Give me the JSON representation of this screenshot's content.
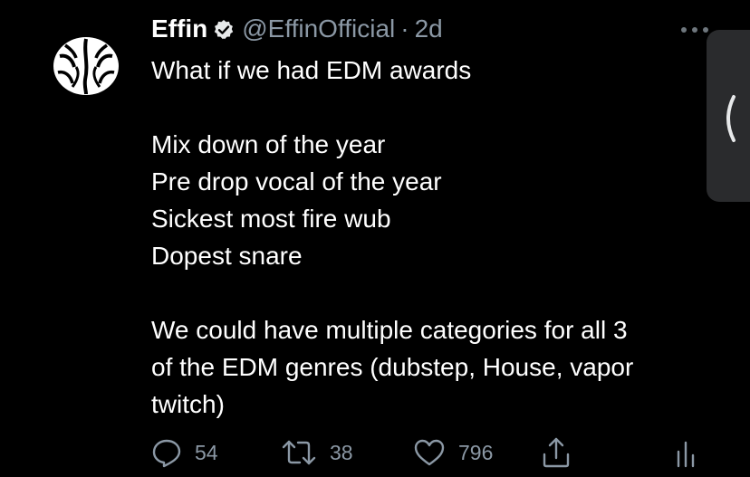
{
  "tweet": {
    "display_name": "Effin",
    "handle": "@EffinOfficial",
    "separator": "·",
    "time": "2d",
    "lines": [
      "What if we had EDM awards",
      "",
      "Mix down of the year",
      "Pre drop vocal of the year",
      "Sickest most fire wub",
      "Dopest snare",
      "",
      "We could have multiple categories for all 3",
      "of the EDM genres (dubstep, House, vapor",
      "twitch)"
    ],
    "stats": {
      "replies": "54",
      "retweets": "38",
      "likes": "796"
    }
  },
  "icons": {
    "verified": "verified-badge-icon",
    "more": "more-dots-icon",
    "reply": "reply-icon",
    "retweet": "retweet-icon",
    "like": "heart-icon",
    "share": "share-icon",
    "analytics": "analytics-icon",
    "side_tab": "chevron-left-icon"
  },
  "colors": {
    "background": "#000000",
    "text": "#ffffff",
    "muted": "#8b98a5",
    "side_tab": "#2a2b2d"
  }
}
